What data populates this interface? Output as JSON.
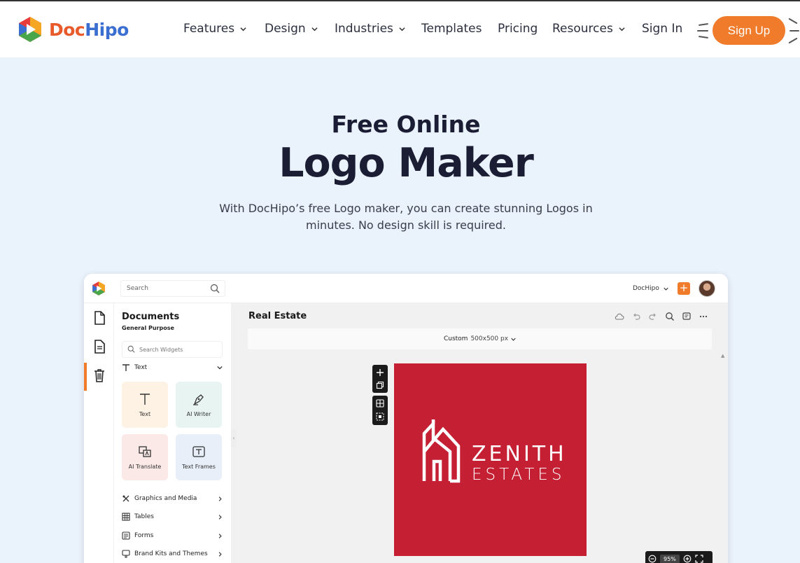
{
  "brand": {
    "name_part1": "Doc",
    "name_part2": "Hipo"
  },
  "nav": {
    "features": "Features",
    "design": "Design",
    "industries": "Industries",
    "templates": "Templates",
    "pricing": "Pricing",
    "resources": "Resources",
    "sign_in": "Sign In",
    "sign_up": "Sign Up"
  },
  "hero": {
    "subtitle": "Free Online",
    "title": "Logo Maker",
    "description": "With DocHipo’s free Logo maker, you can create stunning Logos in minutes. No design skill is required."
  },
  "app": {
    "search_placeholder": "Search",
    "account_label": "DocHipo",
    "panel": {
      "title": "Documents",
      "subtitle": "General Purpose",
      "search_placeholder": "Search Widgets",
      "text_section": "Text",
      "cards": [
        "Text",
        "AI Writer",
        "AI Translate",
        "Text Frames"
      ],
      "sections": [
        "Graphics and Media",
        "Tables",
        "Forms",
        "Brand Kits and Themes"
      ]
    },
    "canvas": {
      "document_title": "Real Estate",
      "size_label": "Custom",
      "size_value": "500x500 px",
      "zoom": "95%"
    },
    "logo": {
      "line1": "ZENITH",
      "line2": "ESTATES",
      "background_color": "#c41f33"
    }
  },
  "colors": {
    "accent_orange": "#f07b2a",
    "page_background": "#eaf2fb",
    "heading": "#1a1d33"
  }
}
